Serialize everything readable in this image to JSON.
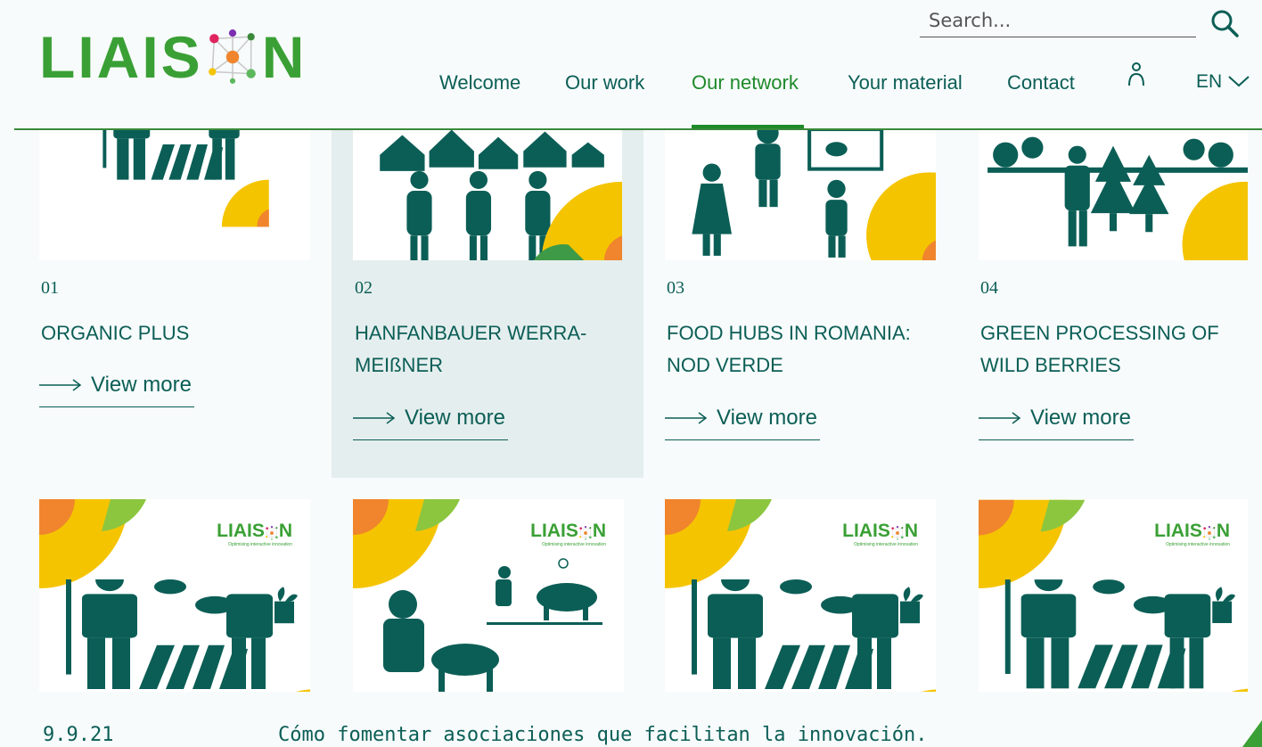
{
  "header": {
    "logo_text_left": "LIAIS",
    "logo_text_right": "N",
    "search_placeholder": "Search...",
    "nav": [
      {
        "label": "Welcome",
        "active": false
      },
      {
        "label": "Our work",
        "active": false
      },
      {
        "label": "Our network",
        "active": true
      },
      {
        "label": "Your material",
        "active": false
      },
      {
        "label": "Contact",
        "active": false
      }
    ],
    "language": "EN",
    "icons": [
      "search-icon",
      "user-icon",
      "chevron-down-icon"
    ],
    "accent_color": "#1f8a2a",
    "text_color": "#0b5e56"
  },
  "cards": [
    {
      "number": "01",
      "title": "ORGANIC PLUS",
      "link": "View more",
      "highlighted": false
    },
    {
      "number": "02",
      "title": "HANFANBAUER WERRA-MEIßNER",
      "link": "View more",
      "highlighted": true
    },
    {
      "number": "03",
      "title": "FOOD HUBS IN ROMANIA: NOD VERDE",
      "link": "View more",
      "highlighted": false
    },
    {
      "number": "04",
      "title": "GREEN PROCESSING OF WILD BERRIES",
      "link": "View more",
      "highlighted": false
    }
  ],
  "row2_cards": [
    {
      "logo_text": "LIAIS",
      "logo_end": "N",
      "tagline": "Optimising interactive innovation"
    },
    {
      "logo_text": "LIAIS",
      "logo_end": "N",
      "tagline": "Optimising interactive innovation"
    },
    {
      "logo_text": "LIAIS",
      "logo_end": "N",
      "tagline": "Optimising interactive innovation"
    },
    {
      "logo_text": "LIAIS",
      "logo_end": "N",
      "tagline": "Optimising interactive innovation"
    }
  ],
  "footer": {
    "date": "9.9.21",
    "text": "Cómo fomentar asociaciones que facilitan la innovación."
  }
}
